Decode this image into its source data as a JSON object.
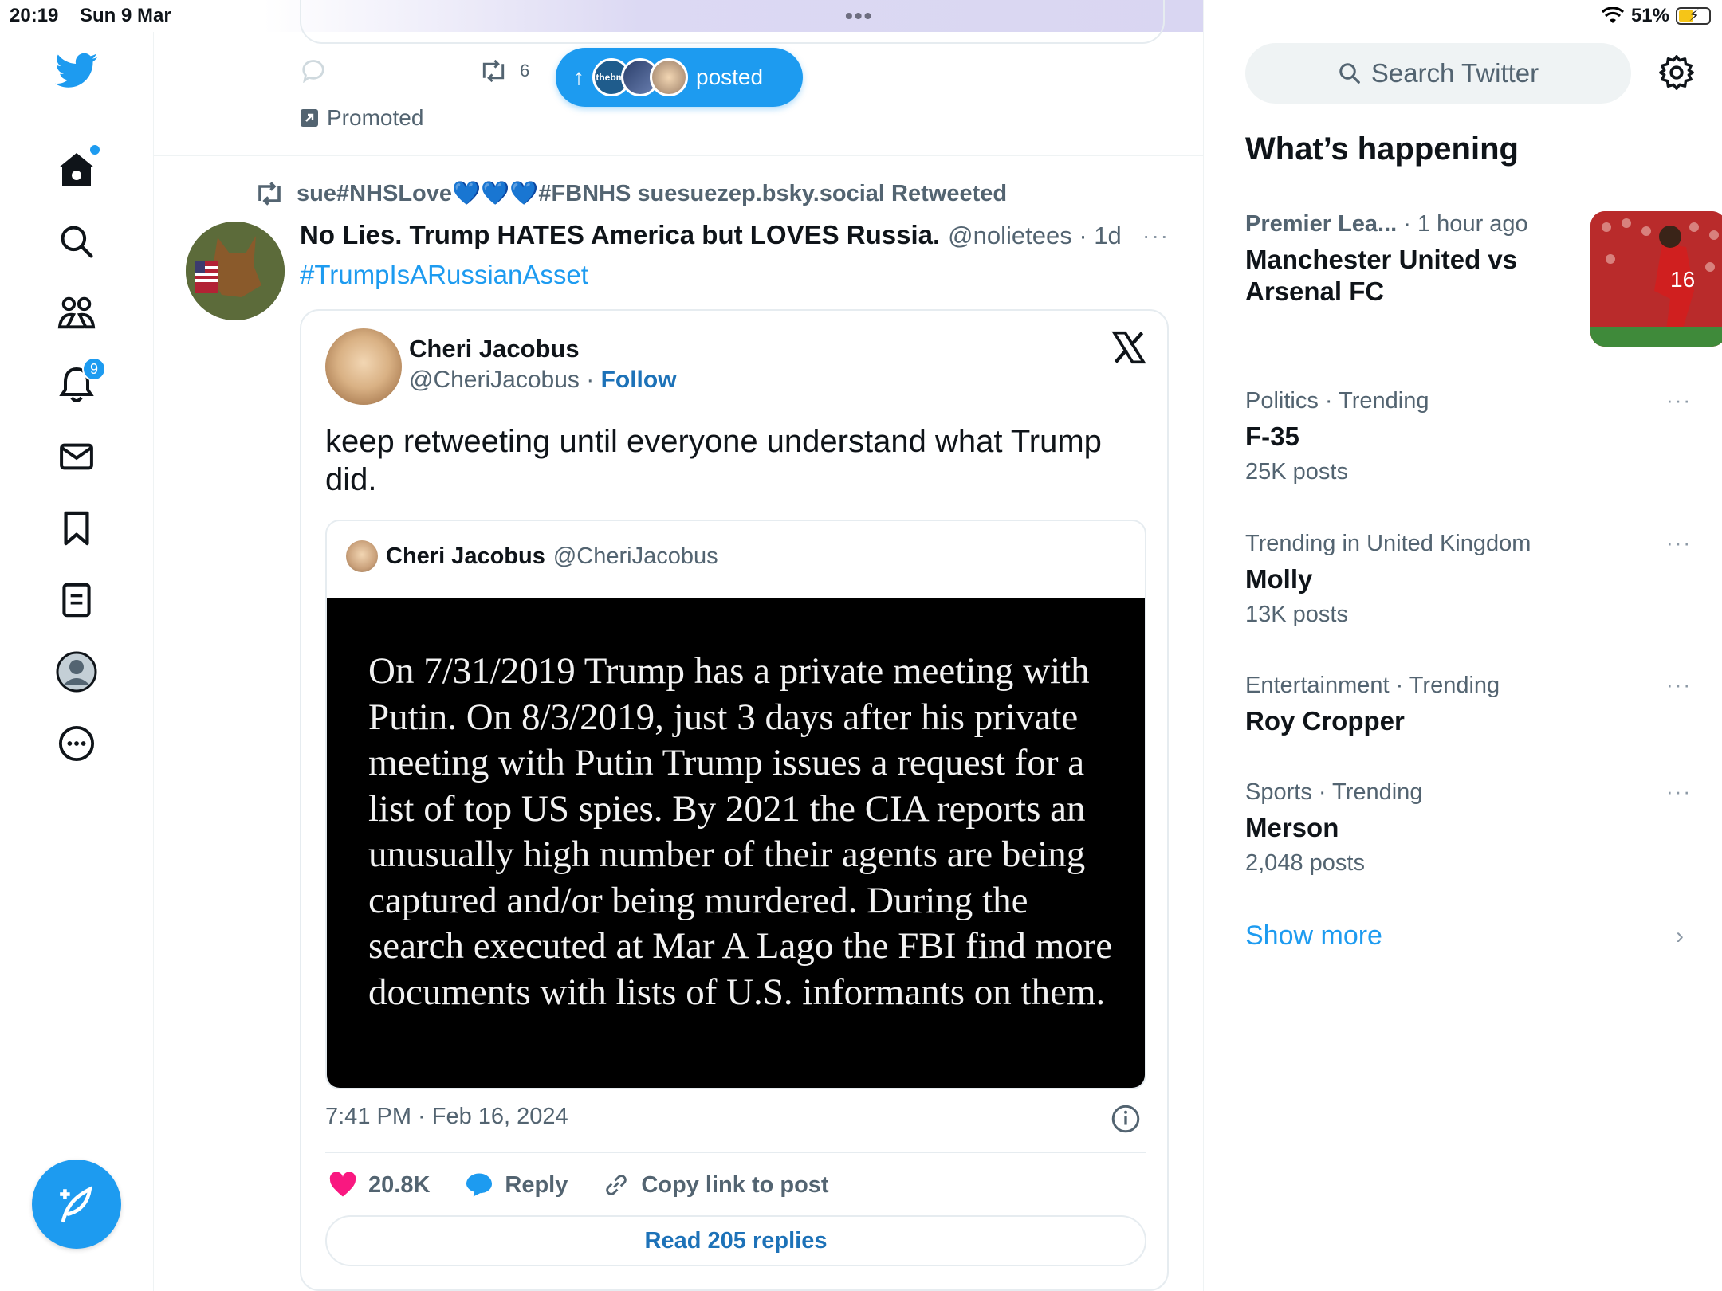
{
  "status_bar": {
    "time": "20:19",
    "date": "Sun 9 Mar",
    "battery": "51%"
  },
  "nav": {
    "notification_count": "9"
  },
  "previous_post": {
    "retweet_count": "6",
    "promoted_label": "Promoted"
  },
  "new_posts_pill": {
    "label": "posted",
    "avatar_text": "thebmj"
  },
  "post": {
    "retweeted_by": "sue#NHSLove💙💙💙#FBNHS suesuezep.bsky.social Retweeted",
    "author_name": "No Lies. Trump HATES America but LOVES Russia.",
    "handle_time": "@nolietees · 1d",
    "more": "···",
    "hashtag": "#TrumpIsARussianAsset",
    "embed": {
      "author_name": "Cheri Jacobus",
      "author_handle": "@CheriJacobus ·",
      "follow_label": "Follow",
      "text": "keep retweeting until everyone understand what Trump did.",
      "quote": {
        "author_name": "Cheri Jacobus",
        "author_handle": "@CheriJacobus",
        "image_text": "On  7/31/2019 Trump has a private meeting with Putin. On 8/3/2019, just 3 days after his private meeting with Putin Trump issues a request for a list of top US spies. By 2021 the CIA reports an unusually high number of their agents are being captured and/or being murdered.  During the search executed at Mar A Lago the FBI find more documents with lists of U.S. informants on them."
      },
      "timestamp": "7:41 PM · Feb 16, 2024",
      "likes": "20.8K",
      "reply_label": "Reply",
      "copy_link_label": "Copy link to post",
      "read_replies_label": "Read 205 replies"
    }
  },
  "sidebar": {
    "search_placeholder": "Search Twitter",
    "title": "What’s happening",
    "featured": {
      "category": "Premier Lea...",
      "time": "· 1 hour ago",
      "title": "Manchester United vs Arsenal FC"
    },
    "trends": [
      {
        "context": "Politics · Trending",
        "name": "F-35",
        "count": "25K posts"
      },
      {
        "context": "Trending in United Kingdom",
        "name": "Molly",
        "count": "13K posts"
      },
      {
        "context": "Entertainment · Trending",
        "name": "Roy Cropper",
        "count": ""
      },
      {
        "context": "Sports · Trending",
        "name": "Merson",
        "count": "2,048 posts"
      }
    ],
    "more_icon": "···",
    "show_more": "Show more"
  },
  "colors": {
    "accent": "#1d9bf0",
    "like": "#f91880",
    "text_secondary": "#536471"
  }
}
